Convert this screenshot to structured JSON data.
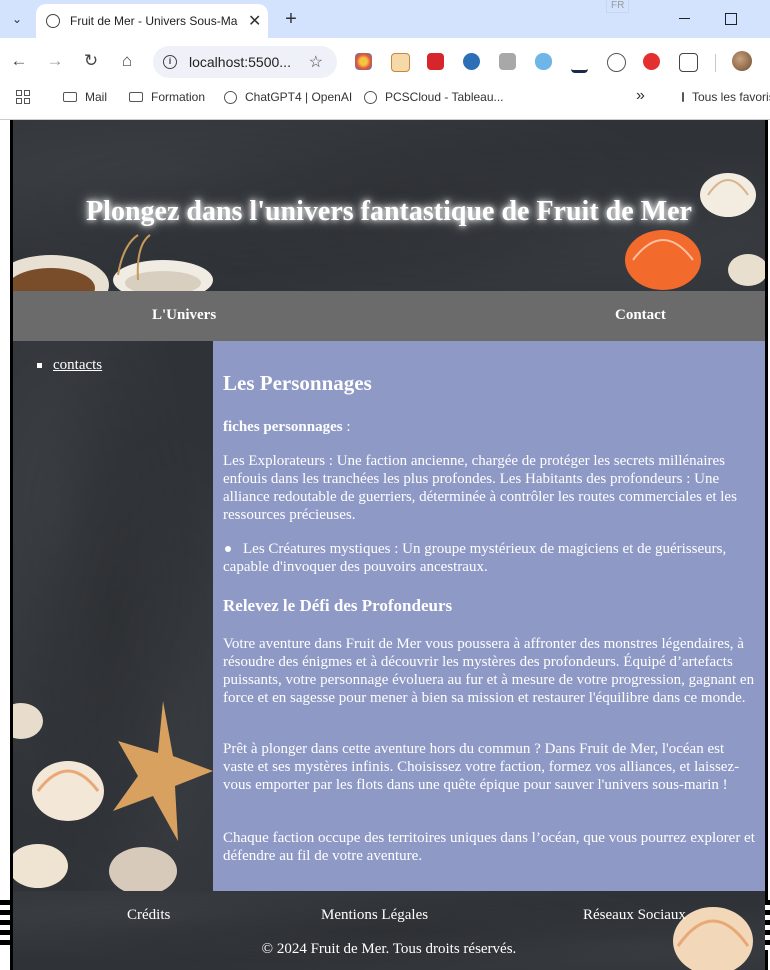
{
  "browser": {
    "tab_title": "Fruit de Mer - Univers Sous-Ma",
    "new_tab": "+",
    "lang": "FR",
    "url": "localhost:5500...",
    "bookmarks": [
      "Mail",
      "Formation",
      "ChatGPT4 | OpenAI",
      "PCSCloud - Tableau..."
    ],
    "overflow": "»",
    "all_bookmarks": "Tous les favoris"
  },
  "page": {
    "hero_title": "Plongez dans l'univers fantastique de Fruit de Mer",
    "nav": [
      "L'Univers",
      "Contact"
    ],
    "sidebar": [
      "contacts"
    ],
    "content": {
      "h1": "Les Personnages",
      "fiches_label": "fiches personnages",
      "fiches_suffix": " :",
      "p_factions": "Les Explorateurs : Une faction ancienne, chargée de protéger les secrets millénaires enfouis dans les tranchées les plus profondes. Les Habitants des profondeurs : Une alliance redoutable de guerriers, déterminée à contrôler les routes commerciales et les ressources précieuses.",
      "bullet": "Les Créatures mystiques : Un groupe mystérieux de magiciens et de guérisseurs, capable d'invoquer des pouvoirs ancestraux.",
      "h2": "Relevez le Défi des Profondeurs",
      "p1": "Votre aventure dans Fruit de Mer vous poussera à affronter des monstres légendaires, à résoudre des énigmes et à découvrir les mystères des profondeurs. Équipé d’artefacts puissants, votre personnage évoluera au fur et à mesure de votre progression, gagnant en force et en sagesse pour mener à bien sa mission et restaurer l'équilibre dans ce monde.",
      "p2": "Prêt à plonger dans cette aventure hors du commun ? Dans Fruit de Mer, l'océan est vaste et ses mystères infinis. Choisissez votre faction, formez vos alliances, et laissez-vous emporter par les flots dans une quête épique pour sauver l'univers sous-marin !",
      "p3": "Chaque faction occupe des territoires uniques dans l’océan, que vous pourrez explorer et défendre au fil de votre aventure."
    },
    "footer": {
      "links": [
        "Crédits",
        "Mentions Légales",
        "Réseaux Sociaux"
      ],
      "copyright": "© 2024 Fruit de Mer. Tous droits réservés."
    }
  },
  "colors": {
    "tabstrip": "#d3e3fd",
    "nav_bg": "#6b6b6b",
    "content_bg": "#8e99c6",
    "chalkboard": "#2f3338"
  }
}
